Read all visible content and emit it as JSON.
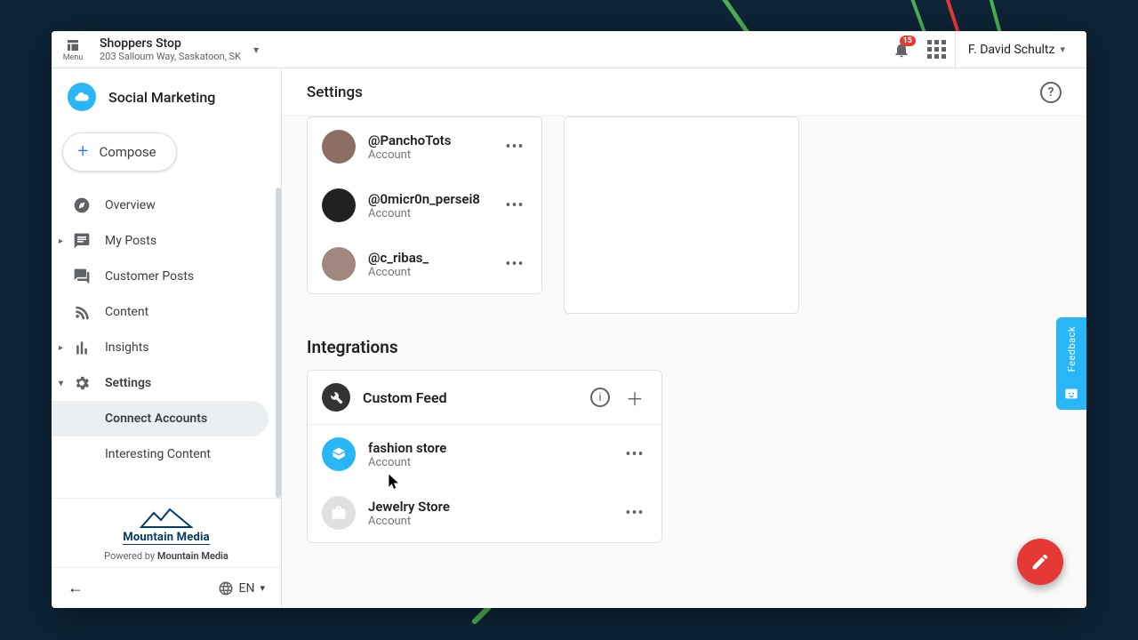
{
  "topbar": {
    "menu_label": "Menu",
    "location_title": "Shoppers Stop",
    "location_address": "203 Salloum Way, Saskatoon, SK",
    "notification_count": "15",
    "user_name": "F. David Schultz"
  },
  "brand": {
    "name": "Social Marketing"
  },
  "compose_label": "Compose",
  "nav": {
    "overview": "Overview",
    "my_posts": "My Posts",
    "customer_posts": "Customer Posts",
    "content": "Content",
    "insights": "Insights",
    "settings": "Settings",
    "settings_sub": {
      "connect_accounts": "Connect Accounts",
      "interesting_content": "Interesting Content"
    }
  },
  "footer": {
    "partner_name": "Mountain Media",
    "powered_prefix": "Powered by ",
    "powered_name": "Mountain Media",
    "lang": "EN"
  },
  "main": {
    "title": "Settings",
    "accounts": [
      {
        "handle": "@PanchoTots",
        "sub": "Account"
      },
      {
        "handle": "@0micr0n_persei8",
        "sub": "Account"
      },
      {
        "handle": "@c_ribas_",
        "sub": "Account"
      }
    ],
    "integrations_title": "Integrations",
    "custom_feed_title": "Custom Feed",
    "integrations": [
      {
        "name": "fashion store",
        "sub": "Account",
        "avatar": "blue"
      },
      {
        "name": "Jewelry Store",
        "sub": "Account",
        "avatar": "gray"
      }
    ]
  },
  "feedback_label": "Feedback"
}
